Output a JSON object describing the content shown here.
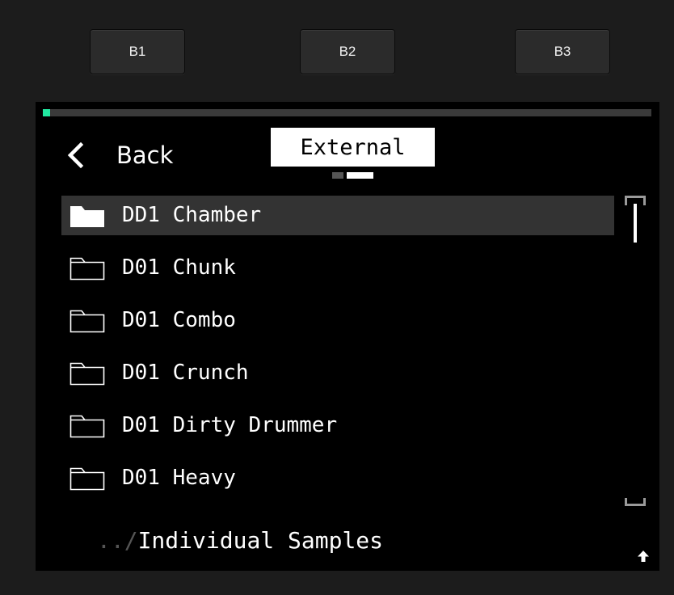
{
  "hardware_buttons": [
    {
      "label": "B1"
    },
    {
      "label": "B2"
    },
    {
      "label": "B3"
    }
  ],
  "screen": {
    "progress": {
      "value": 0.0,
      "color": "#21e8a0"
    },
    "back_label": "Back",
    "tab_title": "External",
    "pages": {
      "count": 2,
      "active": 2
    },
    "list": {
      "items": [
        {
          "label": "DD1 Chamber",
          "selected": true,
          "icon": "folder-filled-icon"
        },
        {
          "label": "D01 Chunk",
          "selected": false,
          "icon": "folder-outline-icon"
        },
        {
          "label": "D01 Combo",
          "selected": false,
          "icon": "folder-outline-icon"
        },
        {
          "label": "D01 Crunch",
          "selected": false,
          "icon": "folder-outline-icon"
        },
        {
          "label": "D01 Dirty Drummer",
          "selected": false,
          "icon": "folder-outline-icon"
        },
        {
          "label": "D01 Heavy",
          "selected": false,
          "icon": "folder-outline-icon"
        }
      ]
    },
    "path": {
      "prefix": "../",
      "current": "Individual Samples"
    }
  },
  "colors": {
    "background": "#1c1c1c",
    "screen": "#000000",
    "accent": "#21e8a0",
    "selected_row": "#333333"
  }
}
